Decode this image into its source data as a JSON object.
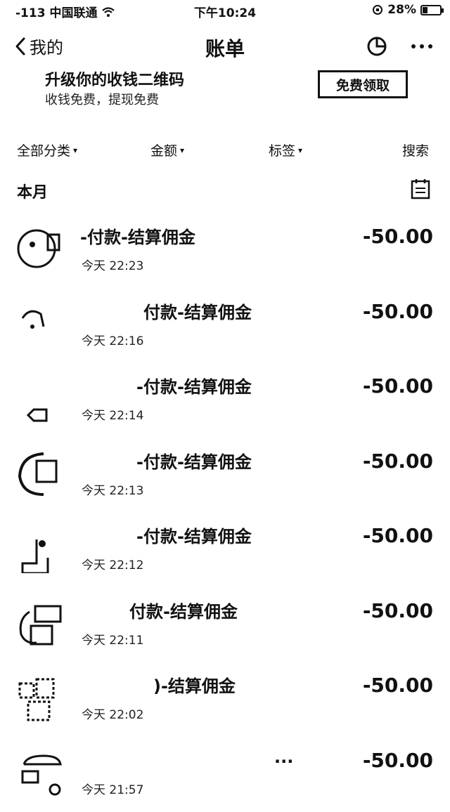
{
  "status_bar": {
    "signal": "-113 中国联通",
    "wifi_icon": "wifi-icon",
    "time": "下午10:24",
    "battery_percent": "28%",
    "battery_level": 0.28
  },
  "nav": {
    "back_label": "我的",
    "title": "账单",
    "pie_icon": "pie-chart-icon",
    "more_icon": "more-icon"
  },
  "promo": {
    "line1": "升级你的收钱二维码",
    "line2": "收钱免费，提现免费",
    "button": "免费领取"
  },
  "filters": [
    {
      "label": "全部分类",
      "caret": "▾"
    },
    {
      "label": "金额",
      "caret": "▾"
    },
    {
      "label": "标签",
      "caret": "▾"
    },
    {
      "label": "搜索",
      "caret": ""
    }
  ],
  "month": {
    "label": "本月",
    "icon": "calendar-icon"
  },
  "transactions": [
    {
      "title": "-付款-结算佣金",
      "time": "今天  22:23",
      "amount": "-50.00"
    },
    {
      "title": "付款-结算佣金",
      "time": "今天  22:16",
      "amount": "-50.00"
    },
    {
      "title": "-付款-结算佣金",
      "time": "今天  22:14",
      "amount": "-50.00"
    },
    {
      "title": "-付款-结算佣金",
      "time": "今天  22:13",
      "amount": "-50.00"
    },
    {
      "title": "-付款-结算佣金",
      "time": "今天  22:12",
      "amount": "-50.00"
    },
    {
      "title": "付款-结算佣金",
      "time": "今天  22:11",
      "amount": "-50.00"
    },
    {
      "title": ")-结算佣金",
      "time": "今天  22:02",
      "amount": "-50.00"
    },
    {
      "title": "...",
      "time": "今天  21:57",
      "amount": "-50.00"
    }
  ]
}
